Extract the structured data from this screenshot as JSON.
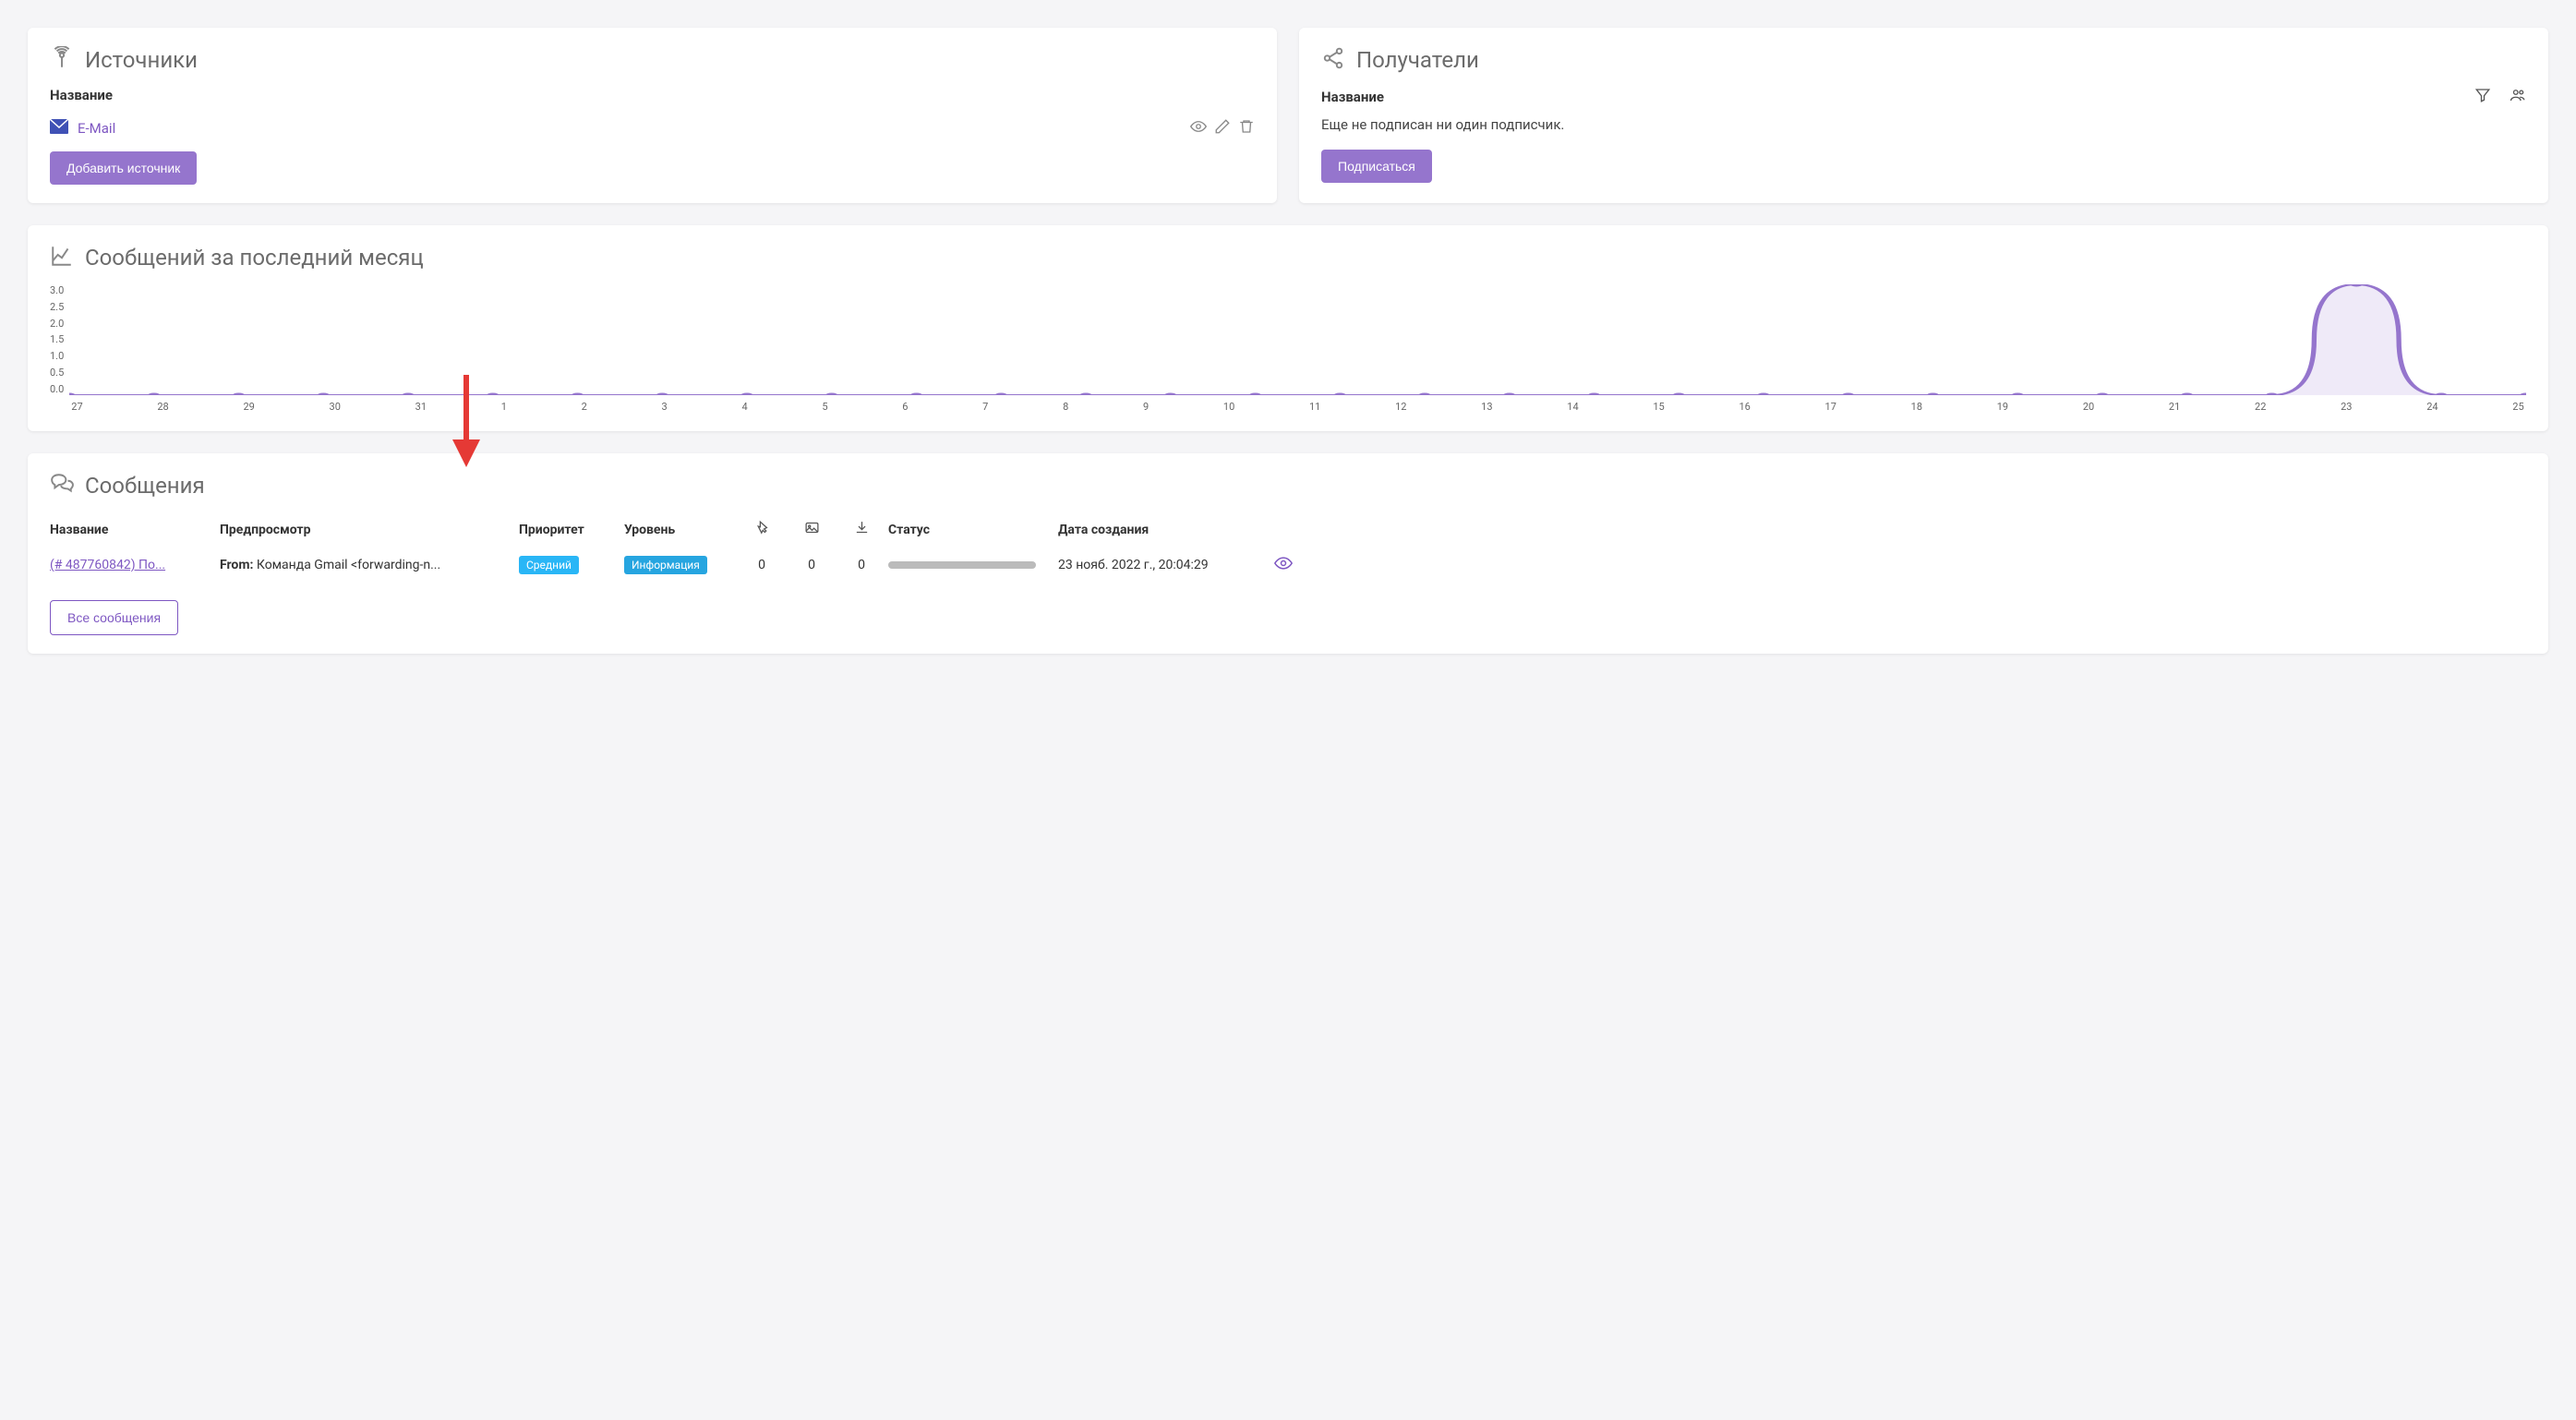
{
  "sources": {
    "title": "Источники",
    "col_name": "Название",
    "items": [
      {
        "label": "E-Mail",
        "icon": "mail-icon"
      }
    ],
    "add_btn": "Добавить источник"
  },
  "recipients": {
    "title": "Получатели",
    "col_name": "Название",
    "empty_text": "Еще не подписан ни один подписчик.",
    "subscribe_btn": "Подписаться"
  },
  "chart_card": {
    "title": "Сообщений за последний месяц"
  },
  "chart_data": {
    "type": "line",
    "categories": [
      "27",
      "28",
      "29",
      "30",
      "31",
      "1",
      "2",
      "3",
      "4",
      "5",
      "6",
      "7",
      "8",
      "9",
      "10",
      "11",
      "12",
      "13",
      "14",
      "15",
      "16",
      "17",
      "18",
      "19",
      "20",
      "21",
      "22",
      "23",
      "24",
      "25"
    ],
    "values": [
      0,
      0,
      0,
      0,
      0,
      0,
      0,
      0,
      0,
      0,
      0,
      0,
      0,
      0,
      0,
      0,
      0,
      0,
      0,
      0,
      0,
      0,
      0,
      0,
      0,
      0,
      0,
      3,
      0,
      0
    ],
    "ylim": [
      0,
      3
    ],
    "yticks": [
      "3.0",
      "2.5",
      "2.0",
      "1.5",
      "1.0",
      "0.5",
      "0.0"
    ],
    "title": "Сообщений за последний месяц",
    "xlabel": "",
    "ylabel": ""
  },
  "messages": {
    "title": "Сообщения",
    "headers": {
      "name": "Название",
      "preview": "Предпросмотр",
      "priority": "Приоритет",
      "level": "Уровень",
      "status": "Статус",
      "created": "Дата создания"
    },
    "rows": [
      {
        "name": "(# 487760842) По...",
        "preview_label": "From:",
        "preview_text": " Команда Gmail <forwarding-n...",
        "priority": "Средний",
        "level": "Информация",
        "clicks": "0",
        "views": "0",
        "downloads": "0",
        "created": "23 нояб. 2022 г., 20:04:29"
      }
    ],
    "all_btn": "Все сообщения"
  }
}
